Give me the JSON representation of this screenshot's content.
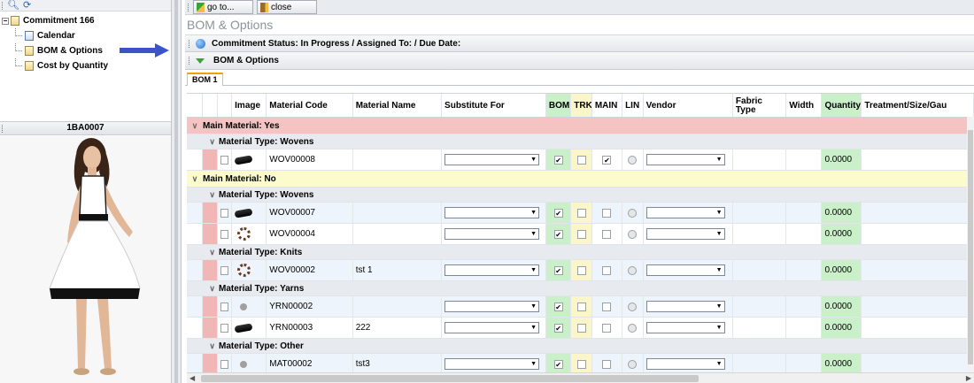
{
  "tree": {
    "root_label": "Commitment 166",
    "toggle": "−",
    "items": [
      {
        "label": "Calendar",
        "icon": "calendar-icon"
      },
      {
        "label": "BOM & Options",
        "icon": "folder-icon"
      },
      {
        "label": "Cost by Quantity",
        "icon": "folder-icon"
      }
    ]
  },
  "image_panel": {
    "title": "1BA0007"
  },
  "toolbar": {
    "goto_label": "go to...",
    "close_label": "close"
  },
  "page": {
    "title": "BOM & Options"
  },
  "status": {
    "text": "Commitment Status: In Progress / Assigned To:  / Due Date:"
  },
  "section": {
    "title": "BOM & Options"
  },
  "tabs": [
    {
      "label": "BOM 1"
    }
  ],
  "columns": [
    "Image",
    "Material Code",
    "Material Name",
    "Substitute For",
    "BOM",
    "TRK",
    "MAIN",
    "LIN",
    "Vendor",
    "Fabric Type",
    "Width",
    "Quantity",
    "Treatment/Size/Gau"
  ],
  "groups": [
    {
      "label": "Main Material: Yes",
      "subgroups": [
        {
          "label": "Material Type: Wovens",
          "rows": [
            {
              "code": "WOV00008",
              "name": "",
              "image": "belt",
              "bom": true,
              "trk": false,
              "main": true,
              "qty": "0.0000"
            }
          ]
        }
      ]
    },
    {
      "label": "Main Material: No",
      "subgroups": [
        {
          "label": "Material Type: Wovens",
          "rows": [
            {
              "code": "WOV00007",
              "name": "",
              "image": "belt",
              "bom": true,
              "trk": false,
              "main": false,
              "qty": "0.0000"
            },
            {
              "code": "WOV00004",
              "name": "",
              "image": "ring",
              "bom": true,
              "trk": false,
              "main": false,
              "qty": "0.0000"
            }
          ]
        },
        {
          "label": "Material Type: Knits",
          "rows": [
            {
              "code": "WOV00002",
              "name": "tst 1",
              "image": "ring",
              "bom": true,
              "trk": false,
              "main": false,
              "qty": "0.0000"
            }
          ]
        },
        {
          "label": "Material Type: Yarns",
          "rows": [
            {
              "code": "YRN00002",
              "name": "",
              "image": "dot",
              "bom": true,
              "trk": false,
              "main": false,
              "qty": "0.0000"
            },
            {
              "code": "YRN00003",
              "name": "222",
              "image": "belt",
              "bom": true,
              "trk": false,
              "main": false,
              "qty": "0.0000"
            }
          ]
        },
        {
          "label": "Material Type: Other",
          "rows": [
            {
              "code": "MAT00002",
              "name": "tst3",
              "image": "dot",
              "bom": true,
              "trk": false,
              "main": false,
              "qty": "0.0000"
            }
          ]
        }
      ]
    }
  ],
  "colors": {
    "bom_col": "#c9f0c9",
    "trk_col": "#fbf6c9",
    "main_yes": "#f6c3c3",
    "main_no": "#fbfbcc",
    "arrow": "#3b55c9"
  }
}
